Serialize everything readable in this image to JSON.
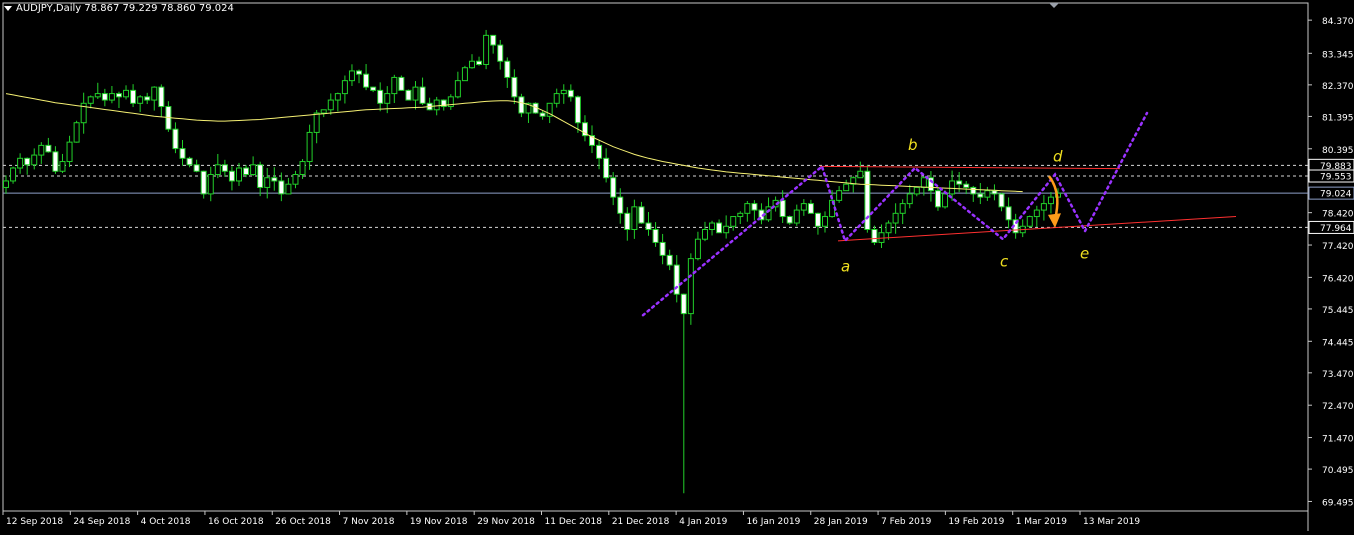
{
  "header": {
    "symbol_line": "AUDJPY,Daily  78.867 79.229 78.860 79.024"
  },
  "chart_data": {
    "type": "candlestick",
    "symbol": "AUDJPY",
    "timeframe": "Daily",
    "ohlc_last": {
      "open": 78.867,
      "high": 79.229,
      "low": 78.86,
      "close": 79.024
    },
    "ylim": [
      69.2,
      84.9
    ],
    "y_ticks": [
      "84.370",
      "83.345",
      "82.370",
      "81.395",
      "80.395",
      "79.553",
      "79.024",
      "78.420",
      "77.420",
      "76.420",
      "75.445",
      "74.445",
      "73.470",
      "72.470",
      "71.470",
      "70.495",
      "69.495"
    ],
    "x_ticks": [
      "12 Sep 2018",
      "24 Sep 2018",
      "4 Oct 2018",
      "16 Oct 2018",
      "26 Oct 2018",
      "7 Nov 2018",
      "19 Nov 2018",
      "29 Nov 2018",
      "11 Dec 2018",
      "21 Dec 2018",
      "4 Jan 2019",
      "16 Jan 2019",
      "28 Jan 2019",
      "7 Feb 2019",
      "19 Feb 2019",
      "1 Mar 2019",
      "13 Mar 2019"
    ],
    "price_labels": [
      {
        "label": "79.883",
        "value": 79.883,
        "style": "dashed-white"
      },
      {
        "label": "79.553",
        "value": 79.553,
        "style": "dashed-white"
      },
      {
        "label": "79.024",
        "value": 79.024,
        "style": "current-price"
      },
      {
        "label": "77.964",
        "value": 77.964,
        "style": "dashed-white"
      }
    ],
    "closes": [
      79.4,
      79.8,
      80.1,
      79.9,
      80.2,
      80.5,
      80.3,
      79.7,
      80.0,
      80.6,
      81.2,
      81.8,
      82.0,
      82.1,
      81.9,
      82.1,
      82.0,
      82.2,
      81.8,
      82.0,
      81.9,
      82.3,
      81.7,
      81.0,
      80.4,
      80.1,
      79.9,
      79.7,
      79.0,
      79.6,
      79.9,
      79.7,
      79.4,
      79.8,
      79.6,
      79.9,
      79.2,
      79.5,
      79.4,
      79.0,
      79.3,
      79.6,
      80.0,
      80.9,
      81.5,
      81.6,
      81.9,
      82.1,
      82.5,
      82.8,
      82.7,
      82.3,
      82.2,
      81.8,
      82.1,
      82.6,
      82.2,
      81.9,
      82.3,
      81.8,
      81.6,
      81.9,
      81.7,
      82.0,
      82.5,
      82.9,
      83.1,
      83.0,
      83.9,
      83.6,
      83.1,
      82.6,
      82.0,
      81.5,
      81.8,
      81.5,
      81.4,
      81.8,
      82.1,
      82.2,
      82.0,
      81.2,
      80.8,
      80.5,
      80.1,
      79.5,
      78.9,
      78.4,
      77.9,
      78.6,
      78.1,
      77.9,
      77.5,
      77.1,
      76.8,
      75.9,
      75.3,
      77.0,
      77.6,
      77.9,
      78.1,
      77.8,
      78.0,
      78.3,
      78.4,
      78.7,
      78.5,
      78.2,
      78.6,
      78.8,
      78.3,
      78.1,
      78.5,
      78.7,
      78.4,
      78.0,
      78.3,
      78.8,
      79.1,
      79.3,
      79.5,
      79.7,
      77.9,
      77.5,
      77.8,
      78.1,
      78.4,
      78.7,
      79.0,
      79.2,
      79.5,
      79.1,
      78.6,
      79.0,
      79.4,
      79.3,
      79.2,
      79.0,
      78.9,
      79.1,
      79.0,
      78.6,
      78.2,
      77.8,
      78.0,
      78.3,
      78.5,
      78.7,
      78.9,
      79.02
    ]
  },
  "overlays": {
    "moving_average": {
      "color": "#f5f073",
      "values": [
        82.1,
        82.06,
        82.02,
        81.98,
        81.94,
        81.9,
        81.86,
        81.82,
        81.79,
        81.76,
        81.73,
        81.7,
        81.67,
        81.64,
        81.61,
        81.58,
        81.55,
        81.52,
        81.49,
        81.46,
        81.43,
        81.4,
        81.38,
        81.36,
        81.34,
        81.32,
        81.3,
        81.28,
        81.27,
        81.26,
        81.25,
        81.25,
        81.26,
        81.27,
        81.28,
        81.29,
        81.3,
        81.32,
        81.34,
        81.36,
        81.38,
        81.4,
        81.42,
        81.44,
        81.46,
        81.48,
        81.5,
        81.52,
        81.54,
        81.56,
        81.58,
        81.6,
        81.61,
        81.62,
        81.63,
        81.64,
        81.65,
        81.66,
        81.67,
        81.68,
        81.7,
        81.72,
        81.74,
        81.76,
        81.78,
        81.8,
        81.82,
        81.84,
        81.86,
        81.87,
        81.88,
        81.88,
        81.86,
        81.82,
        81.76,
        81.68,
        81.58,
        81.48,
        81.36,
        81.24,
        81.12,
        81.0,
        80.88,
        80.76,
        80.66,
        80.56,
        80.46,
        80.38,
        80.3,
        80.22,
        80.16,
        80.1,
        80.05,
        80.0,
        79.96,
        79.92,
        79.88,
        79.84,
        79.8,
        79.77,
        79.74,
        79.71,
        79.68,
        79.66,
        79.64,
        79.62,
        79.6,
        79.58,
        79.56,
        79.54,
        79.52,
        79.5,
        79.48,
        79.46,
        79.44,
        79.42,
        79.4,
        79.38,
        79.36,
        79.34,
        79.32,
        79.3,
        79.29,
        79.28,
        79.27,
        79.26,
        79.25,
        79.24,
        79.23,
        79.22,
        79.21,
        79.2,
        79.19,
        79.18,
        79.17,
        79.16,
        79.15,
        79.14,
        79.13,
        79.12,
        79.11,
        79.1,
        79.09,
        79.08,
        79.07
      ]
    },
    "wave_labels": [
      "a",
      "b",
      "c",
      "d",
      "e"
    ],
    "wave_color": "#9932ff",
    "label_color": "#f0e020",
    "arrow_color": "#ff9b1a",
    "trend_color": "#ff3030",
    "ma_line_color": "#f5f073"
  }
}
